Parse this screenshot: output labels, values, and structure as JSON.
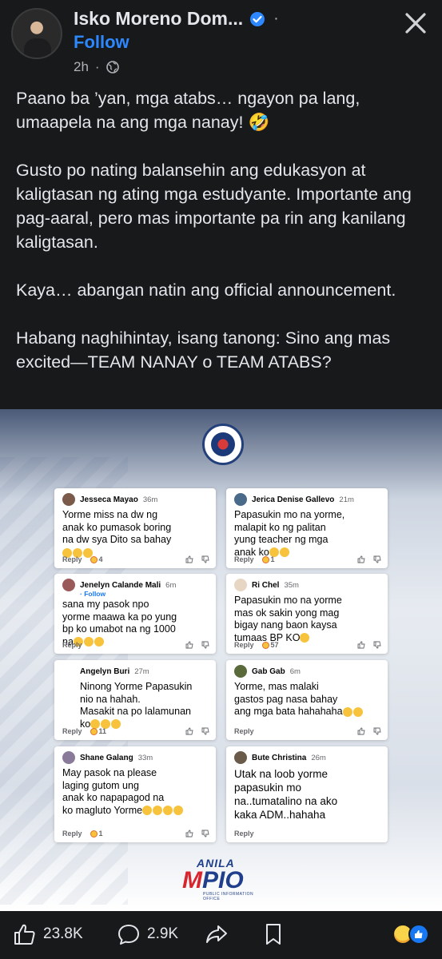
{
  "header": {
    "name": "Isko Moreno Dom...",
    "follow_label": "Follow",
    "time": "2h",
    "separator": "·"
  },
  "post": {
    "paragraphs": [
      "Paano ba ’yan, mga atabs… ngayon pa lang, umaapela na ang mga nanay! 🤣",
      "Gusto po nating balansehin ang edukasyon at kaligtasan ng ating mga estudyante. Importante ang pag-aaral, pero mas importante pa rin ang kanilang kaligtasan.",
      "Kaya… abangan natin ang official announcement.",
      "Habang naghihintay, isang tanong: Sino ang mas excited—TEAM NANAY o TEAM ATABS?"
    ]
  },
  "image": {
    "comments": [
      {
        "name": "Jesseca Mayao",
        "time": "36m",
        "text": "Yorme miss na dw ng\nanak ko pumasok boring\nna dw sya Dito sa bahay",
        "emoji_count": 3,
        "reply": "Reply",
        "reactions": "4"
      },
      {
        "name": "Jerica Denise Gallevo",
        "time": "21m",
        "text": "Papasukin mo na yorme,\nmalapit ko ng palitan\nyung teacher ng mga\nanak ko",
        "emoji_count": 2,
        "reply": "Reply",
        "reactions": "1"
      },
      {
        "name": "Jenelyn Calande Mali",
        "time": "6m",
        "follow": "· Follow",
        "text": "sana my pasok npo\nyorme maawa ka po yung\nbp ko umabot na ng 1000\nna",
        "emoji_count": 3,
        "reply": "Reply",
        "reactions": ""
      },
      {
        "name": "Ri Chel",
        "time": "35m",
        "text": "Papasukin mo na yorme\nmas ok sakin yong mag\nbigay nang baon kaysa\ntumaas BP KO",
        "emoji_count": 1,
        "reply": "Reply",
        "reactions": "57"
      },
      {
        "name": "Angelyn Buri",
        "time": "27m",
        "text": "Ninong Yorme Papasukin\nnio na hahah.\nMasakit na po lalamunan\nko",
        "emoji_count": 3,
        "reply": "Reply",
        "reactions": "11"
      },
      {
        "name": "Gab Gab",
        "time": "6m",
        "text": "Yorme, mas malaki\ngastos pag nasa bahay\nang mga bata hahahaha",
        "emoji_count": 2,
        "reply": "Reply",
        "reactions": ""
      },
      {
        "name": "Shane Galang",
        "time": "33m",
        "text": "May pasok na please\n laging gutom ung\nanak ko napapagod na\nko magluto Yorme",
        "emoji_count": 4,
        "reply": "Reply",
        "reactions": "1"
      },
      {
        "name": "Bute Christina",
        "time": "26m",
        "text": "Utak na loob yorme\npapasukin mo\nna..tumatalino na ako\nkaka ADM..hahaha",
        "emoji_count": 0,
        "reply": "Reply",
        "reactions": ""
      }
    ],
    "logo": {
      "top": "ANILA",
      "big_m": "M",
      "big_rest": "PIO",
      "sub": "PUBLIC INFORMATION OFFICE"
    }
  },
  "bottom_bar": {
    "likes": "23.8K",
    "comments": "2.9K"
  },
  "colors": {
    "background": "#18191a",
    "accent": "#2d88ff",
    "text": "#e4e6eb",
    "muted": "#b0b3b8"
  },
  "icons": [
    "verified-icon",
    "globe-icon",
    "close-icon",
    "like-icon",
    "comment-icon",
    "share-icon",
    "save-icon",
    "haha-reaction-icon",
    "like-reaction-icon"
  ]
}
